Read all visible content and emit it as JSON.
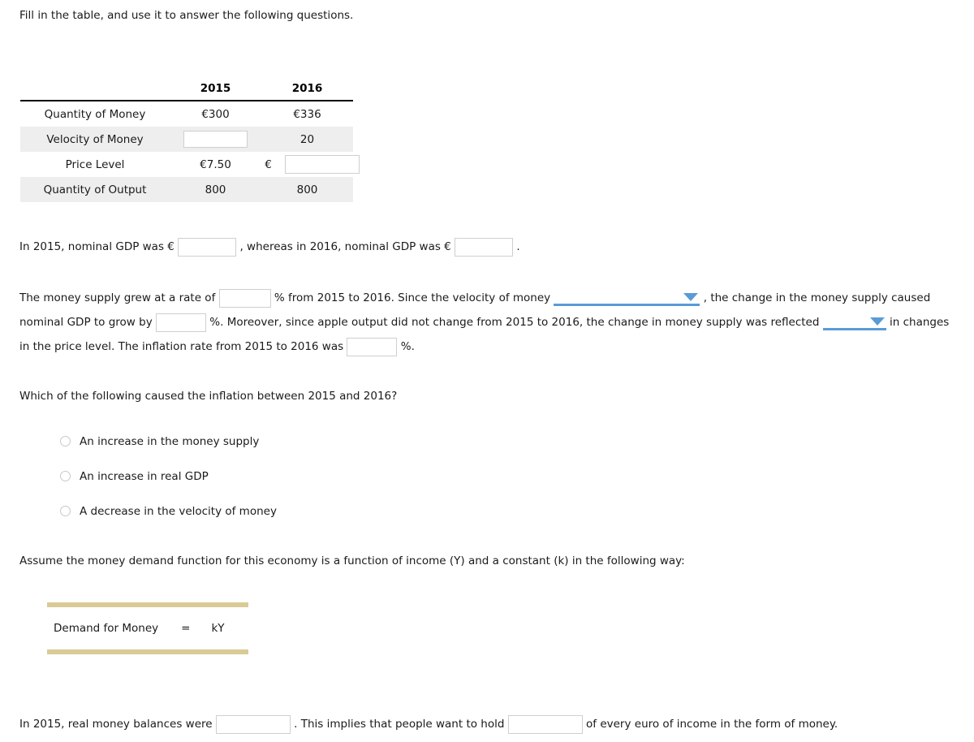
{
  "intro": "Fill in the table, and use it to answer the following questions.",
  "table": {
    "columns": [
      "",
      "2015",
      "2016"
    ],
    "rows": [
      {
        "label": "Quantity of Money",
        "y2015": {
          "type": "text",
          "value": "€300"
        },
        "y2016": {
          "type": "text",
          "value": "€336"
        },
        "shaded": false
      },
      {
        "label": "Velocity of Money",
        "y2015": {
          "type": "input",
          "value": "",
          "placeholder": ""
        },
        "y2016": {
          "type": "text",
          "value": "20"
        },
        "shaded": true
      },
      {
        "label": "Price Level",
        "y2015": {
          "type": "text",
          "value": "€7.50"
        },
        "y2016": {
          "type": "input",
          "value": "",
          "placeholder": "",
          "prefix": "€"
        },
        "shaded": false
      },
      {
        "label": "Quantity of Output",
        "y2015": {
          "type": "text",
          "value": "800"
        },
        "y2016": {
          "type": "text",
          "value": "800"
        },
        "shaded": true
      }
    ]
  },
  "gdp_sentence": {
    "part1": "In 2015, nominal GDP was €",
    "input1": "",
    "part2": ", whereas in 2016, nominal GDP was €",
    "input2": "",
    "part3": "."
  },
  "supply_paragraph": {
    "s1": "The money supply grew at a rate of",
    "input_rate": "",
    "s2": "% from 2015 to 2016. Since the velocity of money",
    "dropdown1": "",
    "s3": ", the change in the money",
    "s4": "supply caused nominal GDP to grow by",
    "input_growth": "",
    "s5": "%. Moreover, since apple output did not change from 2015 to 2016, the change in money supply was",
    "s6": "reflected",
    "dropdown2": "",
    "s7": "in changes in the price level. The inflation rate from 2015 to 2016 was",
    "input_inflation": "",
    "s8": "%."
  },
  "question": {
    "prompt": "Which of the following caused the inflation between 2015 and 2016?",
    "options": [
      {
        "label": "An increase in the money supply",
        "selected": false
      },
      {
        "label": "An increase in real GDP",
        "selected": false
      },
      {
        "label": "A decrease in the velocity of money",
        "selected": false
      }
    ]
  },
  "assume_text": "Assume the money demand function for this economy is a function of income (Y) and a constant (k) in the following way:",
  "demand_box": {
    "label": "Demand for Money",
    "equals": "=",
    "expression": "kY",
    "bar_color": "#d9cb96"
  },
  "real_balances": {
    "part1": "In 2015, real money balances were",
    "input1": "",
    "part2": ". This implies that people want to hold",
    "input2": "",
    "part3": "of every euro of income in the form of money."
  },
  "colors": {
    "accent_blue": "#5b9bd5",
    "row_shade": "#eeeeee",
    "input_border": "#cfcfcf",
    "tan": "#d9cb96"
  }
}
